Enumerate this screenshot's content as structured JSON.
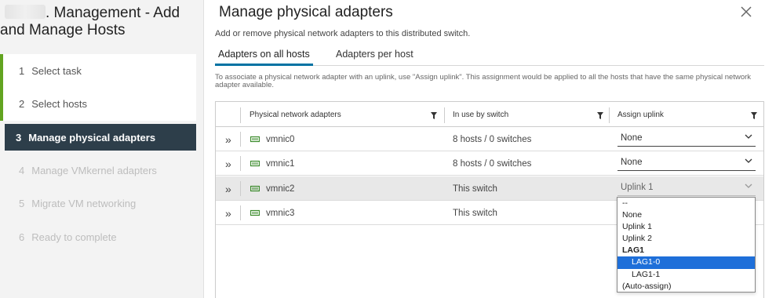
{
  "wizard": {
    "title_line1": ". Management - Add",
    "title_line2": "and Manage Hosts",
    "steps": [
      {
        "num": "1",
        "label": "Select task"
      },
      {
        "num": "2",
        "label": "Select hosts"
      },
      {
        "num": "3",
        "label": "Manage physical adapters"
      },
      {
        "num": "4",
        "label": "Manage VMkernel adapters"
      },
      {
        "num": "5",
        "label": "Migrate VM networking"
      },
      {
        "num": "6",
        "label": "Ready to complete"
      }
    ]
  },
  "main": {
    "title": "Manage physical adapters",
    "close_icon": "close-icon",
    "subtitle": "Add or remove physical network adapters to this distributed switch.",
    "tabs": [
      {
        "label": "Adapters on all hosts",
        "active": true
      },
      {
        "label": "Adapters per host",
        "active": false
      }
    ],
    "hint": "To associate a physical network adapter with an uplink, use \"Assign uplink\". This assignment would be applied to all the hosts that have the same physical network adapter available."
  },
  "table": {
    "columns": [
      "Physical network adapters",
      "In use by switch",
      "Assign uplink"
    ],
    "rows": [
      {
        "name": "vmnic0",
        "switch": "8 hosts / 0 switches",
        "uplink": "None"
      },
      {
        "name": "vmnic1",
        "switch": "8 hosts / 0 switches",
        "uplink": "None"
      },
      {
        "name": "vmnic2",
        "switch": "This switch",
        "uplink": "Uplink 1"
      },
      {
        "name": "vmnic3",
        "switch": "This switch",
        "uplink": ""
      }
    ]
  },
  "dropdown": {
    "options": [
      "--",
      "None",
      "Uplink 1",
      "Uplink 2",
      "LAG1",
      "LAG1-0",
      "LAG1-1",
      "(Auto-assign)"
    ],
    "highlighted": "LAG1-0"
  },
  "colors": {
    "accent": "#0072a3",
    "step_done": "#62a420",
    "step_active_bg": "#2d3e4a",
    "highlight": "#1e6fd9",
    "nic_icon": "#3a8a2a"
  }
}
